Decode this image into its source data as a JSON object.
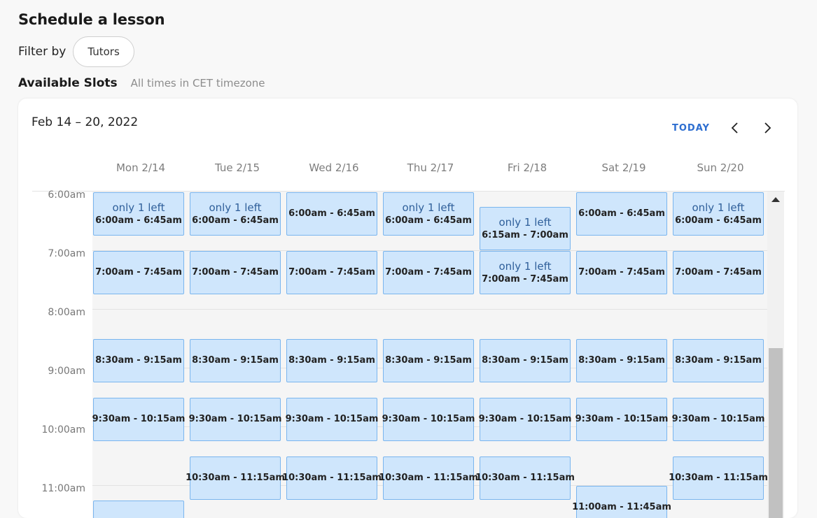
{
  "page": {
    "title": "Schedule a lesson",
    "filter_label": "Filter by",
    "filter_chip": "Tutors",
    "slots_title": "Available Slots",
    "timezone_note": "All times in CET timezone"
  },
  "calendar": {
    "range": "Feb 14 – 20, 2022",
    "today_label": "TODAY",
    "days": [
      "Mon 2/14",
      "Tue 2/15",
      "Wed 2/16",
      "Thu 2/17",
      "Fri 2/18",
      "Sat 2/19",
      "Sun 2/20"
    ],
    "hours": [
      "6:00am",
      "7:00am",
      "8:00am",
      "9:00am",
      "10:00am",
      "11:00am"
    ],
    "accent_color": "#2d6ed0",
    "slot_fill": "#cfe6fc",
    "slot_border": "#7ab5ee",
    "slots": [
      {
        "day": 0,
        "start": 6.0,
        "end": 6.75,
        "note": "only 1 left",
        "time": "6:00am - 6:45am"
      },
      {
        "day": 1,
        "start": 6.0,
        "end": 6.75,
        "note": "only 1 left",
        "time": "6:00am - 6:45am"
      },
      {
        "day": 2,
        "start": 6.0,
        "end": 6.75,
        "note": "",
        "time": "6:00am - 6:45am"
      },
      {
        "day": 3,
        "start": 6.0,
        "end": 6.75,
        "note": "only 1 left",
        "time": "6:00am - 6:45am"
      },
      {
        "day": 4,
        "start": 6.25,
        "end": 7.0,
        "note": "only 1 left",
        "time": "6:15am - 7:00am"
      },
      {
        "day": 5,
        "start": 6.0,
        "end": 6.75,
        "note": "",
        "time": "6:00am - 6:45am"
      },
      {
        "day": 6,
        "start": 6.0,
        "end": 6.75,
        "note": "only 1 left",
        "time": "6:00am - 6:45am"
      },
      {
        "day": 0,
        "start": 7.0,
        "end": 7.75,
        "note": "",
        "time": "7:00am - 7:45am"
      },
      {
        "day": 1,
        "start": 7.0,
        "end": 7.75,
        "note": "",
        "time": "7:00am - 7:45am"
      },
      {
        "day": 2,
        "start": 7.0,
        "end": 7.75,
        "note": "",
        "time": "7:00am - 7:45am"
      },
      {
        "day": 3,
        "start": 7.0,
        "end": 7.75,
        "note": "",
        "time": "7:00am - 7:45am"
      },
      {
        "day": 4,
        "start": 7.0,
        "end": 7.75,
        "note": "only 1 left",
        "time": "7:00am - 7:45am"
      },
      {
        "day": 5,
        "start": 7.0,
        "end": 7.75,
        "note": "",
        "time": "7:00am - 7:45am"
      },
      {
        "day": 6,
        "start": 7.0,
        "end": 7.75,
        "note": "",
        "time": "7:00am - 7:45am"
      },
      {
        "day": 0,
        "start": 8.5,
        "end": 9.25,
        "note": "",
        "time": "8:30am - 9:15am"
      },
      {
        "day": 1,
        "start": 8.5,
        "end": 9.25,
        "note": "",
        "time": "8:30am - 9:15am"
      },
      {
        "day": 2,
        "start": 8.5,
        "end": 9.25,
        "note": "",
        "time": "8:30am - 9:15am"
      },
      {
        "day": 3,
        "start": 8.5,
        "end": 9.25,
        "note": "",
        "time": "8:30am - 9:15am"
      },
      {
        "day": 4,
        "start": 8.5,
        "end": 9.25,
        "note": "",
        "time": "8:30am - 9:15am"
      },
      {
        "day": 5,
        "start": 8.5,
        "end": 9.25,
        "note": "",
        "time": "8:30am - 9:15am"
      },
      {
        "day": 6,
        "start": 8.5,
        "end": 9.25,
        "note": "",
        "time": "8:30am - 9:15am"
      },
      {
        "day": 0,
        "start": 9.5,
        "end": 10.25,
        "note": "",
        "time": "9:30am - 10:15am"
      },
      {
        "day": 1,
        "start": 9.5,
        "end": 10.25,
        "note": "",
        "time": "9:30am - 10:15am"
      },
      {
        "day": 2,
        "start": 9.5,
        "end": 10.25,
        "note": "",
        "time": "9:30am - 10:15am"
      },
      {
        "day": 3,
        "start": 9.5,
        "end": 10.25,
        "note": "",
        "time": "9:30am - 10:15am"
      },
      {
        "day": 4,
        "start": 9.5,
        "end": 10.25,
        "note": "",
        "time": "9:30am - 10:15am"
      },
      {
        "day": 5,
        "start": 9.5,
        "end": 10.25,
        "note": "",
        "time": "9:30am - 10:15am"
      },
      {
        "day": 6,
        "start": 9.5,
        "end": 10.25,
        "note": "",
        "time": "9:30am - 10:15am"
      },
      {
        "day": 1,
        "start": 10.5,
        "end": 11.25,
        "note": "",
        "time": "10:30am - 11:15am"
      },
      {
        "day": 2,
        "start": 10.5,
        "end": 11.25,
        "note": "",
        "time": "10:30am - 11:15am"
      },
      {
        "day": 3,
        "start": 10.5,
        "end": 11.25,
        "note": "",
        "time": "10:30am - 11:15am"
      },
      {
        "day": 4,
        "start": 10.5,
        "end": 11.25,
        "note": "",
        "time": "10:30am - 11:15am"
      },
      {
        "day": 6,
        "start": 10.5,
        "end": 11.25,
        "note": "",
        "time": "10:30am - 11:15am"
      },
      {
        "day": 5,
        "start": 11.0,
        "end": 11.75,
        "note": "",
        "time": "11:00am - 11:45am"
      },
      {
        "day": 0,
        "start": 11.25,
        "end": 12.0,
        "note": "",
        "time": ""
      }
    ]
  }
}
